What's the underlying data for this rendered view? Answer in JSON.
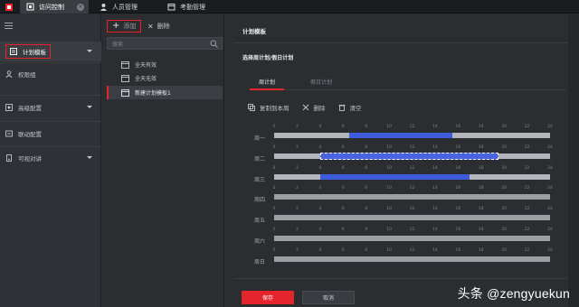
{
  "topbar": {
    "tabs": [
      {
        "label": "访问控制",
        "icon": "access-control-icon",
        "active": true
      },
      {
        "label": "人员管理",
        "icon": "person-icon"
      },
      {
        "label": "考勤管理",
        "icon": "calendar-icon"
      }
    ]
  },
  "leftnav": {
    "items": [
      {
        "label": "计划模板",
        "icon": "template-icon",
        "active": true
      },
      {
        "label": "权限组",
        "icon": "group-icon"
      },
      {
        "label": "高级配置",
        "icon": "advanced-config-icon"
      },
      {
        "label": "联动配置",
        "icon": "linkage-icon"
      },
      {
        "label": "可视对讲",
        "icon": "intercom-icon"
      }
    ]
  },
  "listpanel": {
    "add_label": "添加",
    "delete_label": "删除",
    "search_placeholder": "搜索",
    "templates": [
      {
        "label": "全天有效"
      },
      {
        "label": "全天无效"
      },
      {
        "label": "新建计划模板1",
        "selected": true
      }
    ]
  },
  "main": {
    "section_title": "计划模板",
    "sub_title": "选择周计划/假日计划",
    "tabs": [
      {
        "label": "周计划",
        "active": true
      },
      {
        "label": "假日计划"
      }
    ],
    "actions": {
      "copy": "复制到本周",
      "delete": "删除",
      "clear": "清空"
    },
    "ticks": [
      "0",
      "2",
      "4",
      "6",
      "8",
      "10",
      "12",
      "14",
      "16",
      "18",
      "20",
      "22",
      "24"
    ],
    "days": [
      {
        "label": "周一",
        "segments": [
          [
            6.5,
            15.5
          ]
        ]
      },
      {
        "label": "周二",
        "segments": [
          [
            4,
            19.5
          ]
        ],
        "selected": true
      },
      {
        "label": "周三",
        "segments": [
          [
            4,
            17
          ]
        ]
      },
      {
        "label": "周四",
        "segments": []
      },
      {
        "label": "周五",
        "segments": []
      },
      {
        "label": "周六",
        "segments": []
      },
      {
        "label": "周日",
        "segments": []
      }
    ],
    "save_label": "保存",
    "cancel_label": "取消"
  },
  "colors": {
    "accent": "#e5252c",
    "schedule": "#3e5bdb",
    "bar": "#b3b5ba"
  },
  "watermark": "头条 @zengyuekun"
}
